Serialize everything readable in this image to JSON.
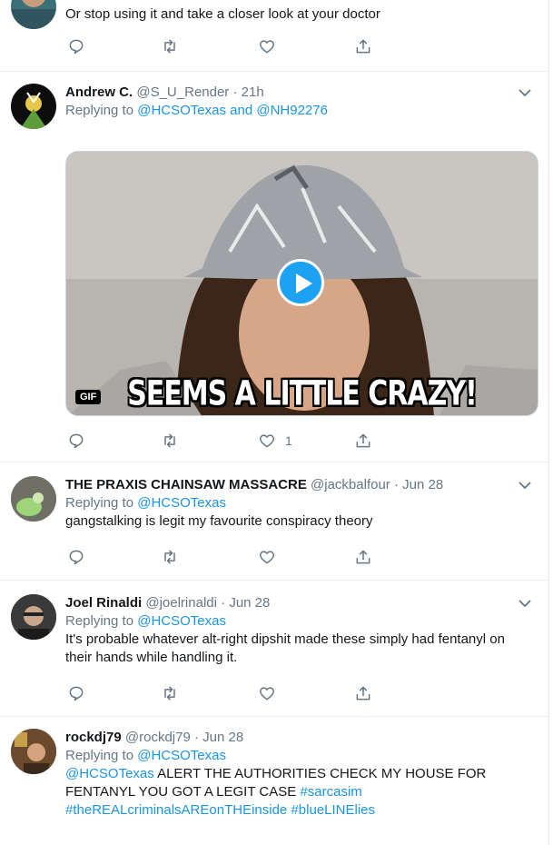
{
  "tweets": [
    {
      "text": "Or stop using it and take a closer look at your doctor",
      "reply_count": "",
      "retweet_count": "",
      "like_count": ""
    },
    {
      "name": "Andrew C.",
      "handle": "@S_U_Render",
      "time": "21h",
      "replying_prefix": "Replying to ",
      "replying_to": [
        "@HCSOTexas",
        "@NH92276"
      ],
      "replying_joiner": " and ",
      "media": {
        "badge": "GIF",
        "caption": "SEEMS A LITTLE CRAZY!"
      },
      "like_count": "1"
    },
    {
      "name": "THE PRAXIS CHAINSAW MASSACRE",
      "handle": "@jackbalfour",
      "time": "Jun 28",
      "replying_prefix": "Replying to ",
      "replying_to": [
        "@HCSOTexas"
      ],
      "text": "gangstalking is legit my favourite conspiracy theory"
    },
    {
      "name": "Joel Rinaldi",
      "handle": "@joelrinaldi",
      "time": "Jun 28",
      "replying_prefix": "Replying to ",
      "replying_to": [
        "@HCSOTexas"
      ],
      "text_line1": "It's probable whatever alt-right dipshit made these simply had fentanyl on",
      "text_line2": "their hands while handling it."
    },
    {
      "name": "rockdj79",
      "handle": "@rockdj79",
      "time": "Jun 28",
      "replying_prefix": "Replying to ",
      "replying_to": [
        "@HCSOTexas"
      ],
      "mention": "@HCSOTexas",
      "text_line1_rest": " ALERT THE AUTHORITIES CHECK MY HOUSE FOR",
      "text_line2": "FENTANYL YOU GOT A LEGIT CASE ",
      "hashtag1": "#sarcasim",
      "hashtag2": "#theREALcriminalsAREonTHEinside",
      "hashtag3": "#blueLINElies"
    }
  ],
  "separator": " · ",
  "colors": {
    "link": "#1b95e0",
    "muted": "#657786",
    "border": "#e6ecf0",
    "play": "#1da1f2"
  }
}
